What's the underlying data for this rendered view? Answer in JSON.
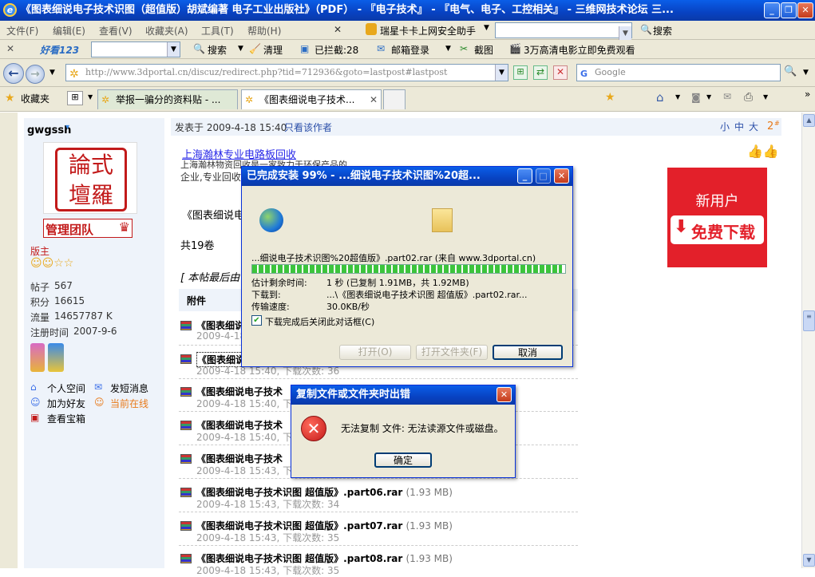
{
  "window": {
    "title": "《图表细说电子技术识图（超值版）胡斌编著 电子工业出版社》（PDF） - 『电子技术』 - 『电气、电子、工控相关』 - 三维网技术论坛 三..."
  },
  "menu": [
    "文件(F)",
    "编辑(E)",
    "查看(V)",
    "收藏夹(A)",
    "工具(T)",
    "帮助(H)"
  ],
  "toolbar2": {
    "rising": "瑞星卡卡上网安全助手",
    "search": "搜索",
    "haokan": "好看123",
    "search2": "搜索",
    "clean": "清理",
    "blocked": "已拦截:28",
    "mail": "邮箱登录",
    "screenshot": "截图",
    "movie": "3万高清电影立即免费观看"
  },
  "address": {
    "url": "http://www.3dportal.cn/discuz/redirect.php?tid=712936&goto=lastpost#lastpost",
    "search_placeholder": "Google"
  },
  "tabs": {
    "favorites": "收藏夹",
    "items": [
      "举报一骗分的资料贴 - ...",
      "《图表细说电子技术..."
    ]
  },
  "user": {
    "name": "gwgssh",
    "group_badge": "管理团队",
    "role": "版主",
    "stats": [
      {
        "label": "帖子",
        "value": "567"
      },
      {
        "label": "积分",
        "value": "16615"
      },
      {
        "label": "流量",
        "value": "14657787 K"
      },
      {
        "label": "注册时间",
        "value": "2007-9-6"
      }
    ],
    "links": [
      "个人空间",
      "发短消息",
      "加为好友",
      "当前在线",
      "查看宝箱"
    ]
  },
  "post": {
    "posted": "发表于 2009-4-18 15:40",
    "author_only": "只看该作者",
    "font_sizes": [
      "小",
      "中",
      "大"
    ],
    "floor": "2",
    "ad_link": "上海瀚林专业电路板回收",
    "ad_text1": "上海瀚林物资回收是一家致力于环保产品的",
    "ad_text2": "企业,专业回收",
    "body_line": "《图表细说电",
    "count": "共19卷",
    "edit_note": "[ 本帖最后由",
    "attach_header": "附件",
    "banner_top": "新用户",
    "banner_btn": "免费下载"
  },
  "files": [
    {
      "name": "《图表细说",
      "size": "",
      "meta": "2009-4-18"
    },
    {
      "name": "《图表细说",
      "size": "",
      "meta": "2009-4-18 15:40, 下载次数: 36"
    },
    {
      "name": "《图表细说电子技术",
      "size": "",
      "meta": "2009-4-18 15:40, 下载"
    },
    {
      "name": "《图表细说电子技术",
      "size": "",
      "meta": "2009-4-18 15:40, 下载"
    },
    {
      "name": "《图表细说电子技术",
      "size": "",
      "meta": "2009-4-18 15:43, 下载"
    },
    {
      "name": "《图表细说电子技术识图 超值版》.part06.rar",
      "size": "(1.93 MB)",
      "meta": "2009-4-18 15:43, 下载次数: 34"
    },
    {
      "name": "《图表细说电子技术识图 超值版》.part07.rar",
      "size": "(1.93 MB)",
      "meta": "2009-4-18 15:43, 下载次数: 35"
    },
    {
      "name": "《图表细说电子技术识图 超值版》.part08.rar",
      "size": "(1.93 MB)",
      "meta": "2009-4-18 15:43, 下载次数: 35"
    }
  ],
  "download_dialog": {
    "title": "已完成安装 99% - ...细说电子技术识图%20超...",
    "file_line": "...细说电子技术识图%20超值版》.part02.rar (来自 www.3dportal.cn)",
    "progress": 0.99,
    "remaining_label": "估计剩余时间:",
    "remaining_value": "1 秒 (已复制 1.91MB，共 1.92MB)",
    "dest_label": "下载到:",
    "dest_value": "...\\《图表细说电子技术识图 超值版》.part02.rar...",
    "speed_label": "传输速度:",
    "speed_value": "30.0KB/秒",
    "checkbox": "下载完成后关闭此对话框(C)",
    "open": "打开(O)",
    "open_folder": "打开文件夹(F)",
    "cancel": "取消"
  },
  "error_dialog": {
    "title": "复制文件或文件夹时出错",
    "message": "无法复制 文件: 无法读源文件或磁盘。",
    "ok": "确定"
  }
}
